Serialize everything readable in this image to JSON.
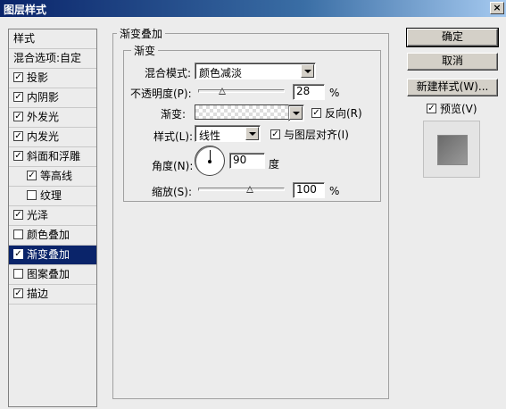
{
  "window": {
    "title": "图层样式",
    "close_symbol": "×"
  },
  "style_list": {
    "header": "样式",
    "blend_options": "混合选项:自定",
    "items": [
      {
        "label": "投影",
        "checked": true
      },
      {
        "label": "内阴影",
        "checked": true
      },
      {
        "label": "外发光",
        "checked": true
      },
      {
        "label": "内发光",
        "checked": true
      },
      {
        "label": "斜面和浮雕",
        "checked": true
      },
      {
        "label": "等高线",
        "checked": true
      },
      {
        "label": "纹理",
        "checked": false
      },
      {
        "label": "光泽",
        "checked": true
      },
      {
        "label": "颜色叠加",
        "checked": false
      },
      {
        "label": "渐变叠加",
        "checked": true
      },
      {
        "label": "图案叠加",
        "checked": false
      },
      {
        "label": "描边",
        "checked": true
      }
    ]
  },
  "gradient_overlay": {
    "group_title": "渐变叠加",
    "sub_group_title": "渐变",
    "blend_mode_label": "混合模式:",
    "blend_mode_value": "颜色减淡",
    "opacity_label": "不透明度(P):",
    "opacity_value": "28",
    "opacity_fraction": 0.28,
    "percent": "%",
    "gradient_label": "渐变:",
    "reverse_label": "反向(R)",
    "reverse_checked": true,
    "style_label": "样式(L):",
    "style_value": "线性",
    "align_label": "与图层对齐(I)",
    "align_checked": true,
    "angle_label": "角度(N):",
    "angle_value": "90",
    "angle_unit": "度",
    "scale_label": "缩放(S):",
    "scale_value": "100",
    "scale_fraction": 0.6
  },
  "buttons": {
    "ok": "确定",
    "cancel": "取消",
    "new_style": "新建样式(W)...",
    "preview_label": "预览(V)",
    "preview_checked": true
  },
  "check_mark": "✓"
}
